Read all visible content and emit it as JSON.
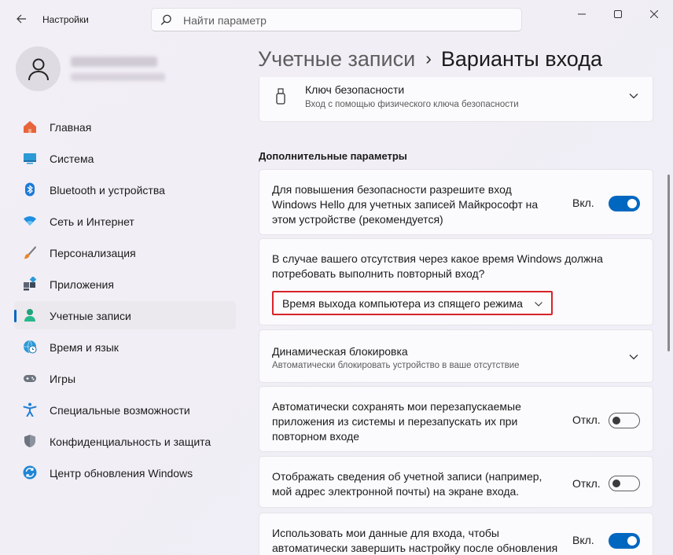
{
  "app": {
    "title": "Настройки"
  },
  "search": {
    "placeholder": "Найти параметр"
  },
  "colors": {
    "accent": "#0067c0",
    "highlight_border": "#d8232a"
  },
  "nav": {
    "items": [
      {
        "label": "Главная",
        "icon": "home-icon"
      },
      {
        "label": "Система",
        "icon": "display-icon"
      },
      {
        "label": "Bluetooth и устройства",
        "icon": "bluetooth-icon"
      },
      {
        "label": "Сеть и Интернет",
        "icon": "wifi-icon"
      },
      {
        "label": "Персонализация",
        "icon": "brush-icon"
      },
      {
        "label": "Приложения",
        "icon": "apps-icon"
      },
      {
        "label": "Учетные записи",
        "icon": "account-icon",
        "active": true
      },
      {
        "label": "Время и язык",
        "icon": "globe-clock-icon"
      },
      {
        "label": "Игры",
        "icon": "gamepad-icon"
      },
      {
        "label": "Специальные возможности",
        "icon": "accessibility-icon"
      },
      {
        "label": "Конфиденциальность и защита",
        "icon": "shield-icon"
      },
      {
        "label": "Центр обновления Windows",
        "icon": "update-icon"
      }
    ]
  },
  "breadcrumb": {
    "parent": "Учетные записи",
    "separator": "›",
    "current": "Варианты входа"
  },
  "main": {
    "security_key": {
      "title": "Ключ безопасности",
      "subtitle": "Вход с помощью физического ключа безопасности"
    },
    "section_title": "Дополнительные параметры",
    "hello_only": {
      "lines": [
        "Для повышения безопасности разрешите вход",
        "Windows Hello для учетных записей Майкрософт на",
        "этом устройстве (рекомендуется)"
      ],
      "state_label": "Вкл.",
      "on": true
    },
    "require_signin": {
      "lines": [
        "В случае вашего отсутствия через какое время Windows должна",
        "потребовать выполнить повторный вход?"
      ],
      "selected": "Время выхода компьютера из спящего режима"
    },
    "dynamic_lock": {
      "title": "Динамическая блокировка",
      "subtitle": "Автоматически блокировать устройство в ваше отсутствие"
    },
    "restart_apps": {
      "lines": [
        "Автоматически сохранять мои перезапускаемые",
        "приложения из системы и перезапускать их при",
        "повторном входе"
      ],
      "state_label": "Откл.",
      "on": false
    },
    "account_details": {
      "lines": [
        "Отображать сведения об учетной записи (например,",
        "мой адрес электронной почты) на экране входа."
      ],
      "state_label": "Откл.",
      "on": false
    },
    "use_signin_info": {
      "lines": [
        "Использовать мои данные для входа, чтобы",
        "автоматически завершить настройку после обновления"
      ],
      "state_label": "Вкл.",
      "on": true
    }
  }
}
